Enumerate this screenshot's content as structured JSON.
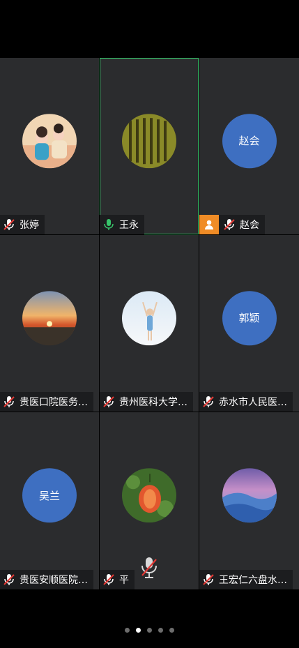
{
  "participants": [
    {
      "name": "张婷",
      "avatar": "photo-couple",
      "mic": "muted"
    },
    {
      "name": "王永",
      "avatar": "photo-calligraphy",
      "mic": "active",
      "speaking": true
    },
    {
      "name": "赵会",
      "avatar_text": "赵会",
      "mic": "muted",
      "host": true
    },
    {
      "name": "贵医口院医务…",
      "avatar": "photo-sunset",
      "mic": "muted"
    },
    {
      "name": "贵州医科大学…",
      "avatar": "photo-girl-sky",
      "mic": "muted"
    },
    {
      "name": "赤水市人民医…",
      "avatar_text": "郭颖",
      "mic": "muted"
    },
    {
      "name": "贵医安顺医院…",
      "avatar_text": "吴兰",
      "mic": "muted"
    },
    {
      "name": "平",
      "avatar": "photo-flower",
      "mic": "muted"
    },
    {
      "name": "王宏仁六盘水…",
      "avatar": "photo-dunes",
      "mic": "muted"
    }
  ],
  "pagination": {
    "count": 5,
    "active_index": 1
  },
  "colors": {
    "active_border": "#37c46a",
    "host_badge": "#f08c26",
    "text_avatar": "#3e6fc1",
    "tile_bg": "#2b2c2e"
  }
}
